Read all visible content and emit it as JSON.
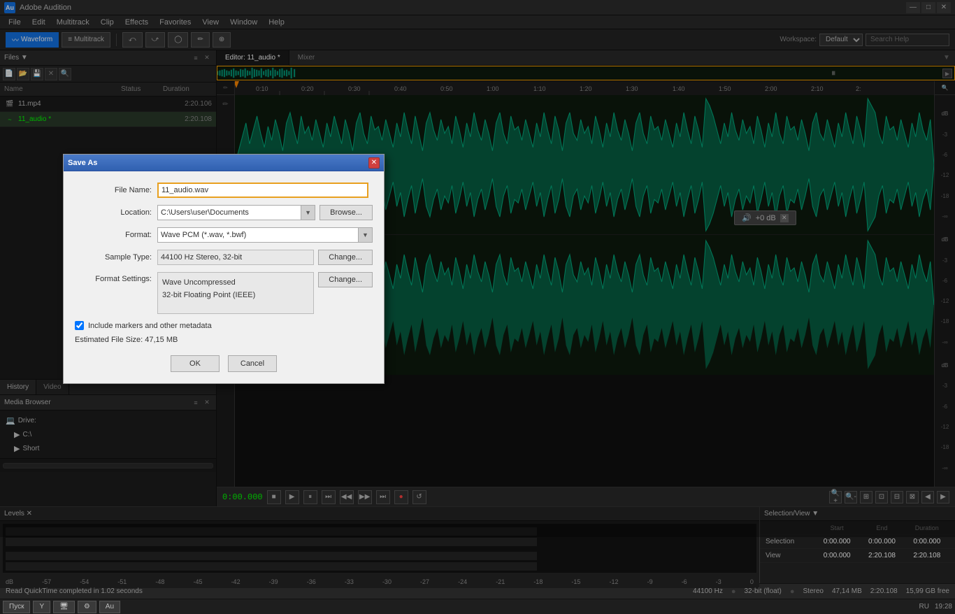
{
  "app": {
    "title": "Adobe Audition",
    "icon": "Au"
  },
  "titlebar": {
    "title": "Adobe Audition",
    "minimize": "—",
    "maximize": "□",
    "close": "✕"
  },
  "menubar": {
    "items": [
      "File",
      "Edit",
      "Multitrack",
      "Clip",
      "Effects",
      "Favorites",
      "View",
      "Window",
      "Help"
    ]
  },
  "toolbar": {
    "waveform_label": "Waveform",
    "multitrack_label": "Multitrack",
    "workspace_label": "Workspace:",
    "workspace_value": "Default",
    "search_placeholder": "Search Help"
  },
  "files_panel": {
    "title": "Files ▼",
    "columns": {
      "name": "Name",
      "status": "Status",
      "duration": "Duration"
    },
    "items": [
      {
        "icon": "🎬",
        "name": "11.mp4",
        "status": "",
        "duration": "2:20.106"
      },
      {
        "icon": "~",
        "name": "11_audio *",
        "status": "",
        "duration": "2:20.108"
      }
    ]
  },
  "media_browser": {
    "title": "Media Browser",
    "drives": [
      {
        "icon": "💻",
        "name": "Drive:"
      },
      {
        "icon": "📁",
        "name": "C:\\"
      },
      {
        "icon": "📁",
        "name": "Short"
      }
    ]
  },
  "editor": {
    "tab_label": "Editor: 11_audio *",
    "mixer_label": "Mixer"
  },
  "ruler": {
    "marks": [
      "0:10",
      "0:20",
      "0:30",
      "0:40",
      "0:50",
      "1:00",
      "1:10",
      "1:20",
      "1:30",
      "1:40",
      "1:50",
      "2:00",
      "2:10",
      "2:"
    ]
  },
  "volume_popup": {
    "value": "+0 dB",
    "close": "✕"
  },
  "playback": {
    "time": "0:00.000",
    "btns": [
      "■",
      "▶",
      "⏸",
      "⏭",
      "◀◀",
      "▶▶",
      "⏭"
    ],
    "record_btn": "●"
  },
  "levels": {
    "title": "Levels ✕",
    "scale": [
      "-57",
      "-54",
      "-51",
      "-48",
      "-45",
      "-42",
      "-39",
      "-36",
      "-33",
      "-30",
      "-27",
      "-24",
      "-21",
      "-18",
      "-15",
      "-12",
      "-9",
      "-6",
      "-3",
      "0"
    ]
  },
  "selection_view": {
    "title": "Selection/View ▼",
    "headers": [
      "Start",
      "End",
      "Duration"
    ],
    "selection_label": "Selection",
    "view_label": "View",
    "selection_values": {
      "start": "0:00.000",
      "end": "0:00.000",
      "duration": "0:00.000"
    },
    "view_values": {
      "start": "0:00.000",
      "end": "2:20.108",
      "duration": "2:20.108"
    }
  },
  "statusbar": {
    "message": "Read QuickTime completed in 1.02 seconds",
    "sample_rate": "44100 Hz",
    "bit_depth": "32-bit (float)",
    "channels": "Stereo",
    "file_size": "47,14 MB",
    "duration": "2:20.108",
    "free": "15,99 GB free"
  },
  "taskbar": {
    "start_btn": "Пуск",
    "locale": "RU",
    "time": "19:28",
    "apps": [
      "Y",
      "🖥",
      "⚙",
      "Au"
    ]
  },
  "history_panel": {
    "tab1": "History",
    "tab2": "Video"
  },
  "dialog": {
    "title": "Save As",
    "close_btn": "✕",
    "file_name_label": "File Name:",
    "file_name_value": "11_audio.wav",
    "location_label": "Location:",
    "location_value": "C:\\Users\\user\\Documents",
    "location_browse": "Browse...",
    "format_label": "Format:",
    "format_value": "Wave PCM (*.wav, *.bwf)",
    "sample_type_label": "Sample Type:",
    "sample_type_value": "44100 Hz Stereo, 32-bit",
    "sample_change_btn": "Change...",
    "format_settings_label": "Format Settings:",
    "format_settings_change_btn": "Change...",
    "format_settings_text1": "Wave Uncompressed",
    "format_settings_text2": "32-bit Floating Point (IEEE)",
    "include_markers_label": "Include markers and other metadata",
    "estimated_size_label": "Estimated File Size:",
    "estimated_size_value": "47,15 MB",
    "ok_btn": "OK",
    "cancel_btn": "Cancel"
  }
}
